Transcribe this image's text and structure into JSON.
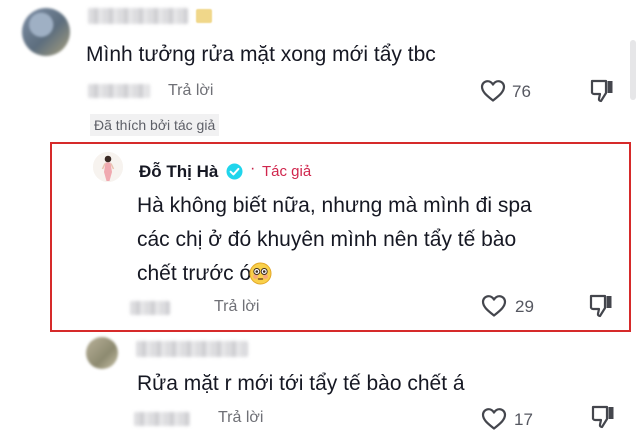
{
  "comments": [
    {
      "text": "Mình tưởng rửa mặt xong mới tẩy tbc",
      "reply_label": "Trả lời",
      "like_count": "76",
      "liked_by_author_label": "Đã thích bởi tác giả"
    },
    {
      "author_name": "Đỗ Thị Hà",
      "author_tag": "Tác giả",
      "dot": "·",
      "text_lines": [
        "Hà không biết nữa, nhưng mà mình đi spa",
        "các chị ở đó khuyên mình nên tẩy tế bào",
        "chết trước ó"
      ],
      "emoji": "flushed-face-icon",
      "reply_label": "Trả lời",
      "like_count": "29",
      "highlight_color": "#d62a2a"
    },
    {
      "text": "Rửa mặt r mới tới tẩy tế bào chết á",
      "reply_label": "Trả lời",
      "like_count": "17"
    }
  ],
  "colors": {
    "text": "#161823",
    "muted": "#6f7076",
    "author_tag": "#d0264d",
    "verified": "#20d5ec"
  }
}
